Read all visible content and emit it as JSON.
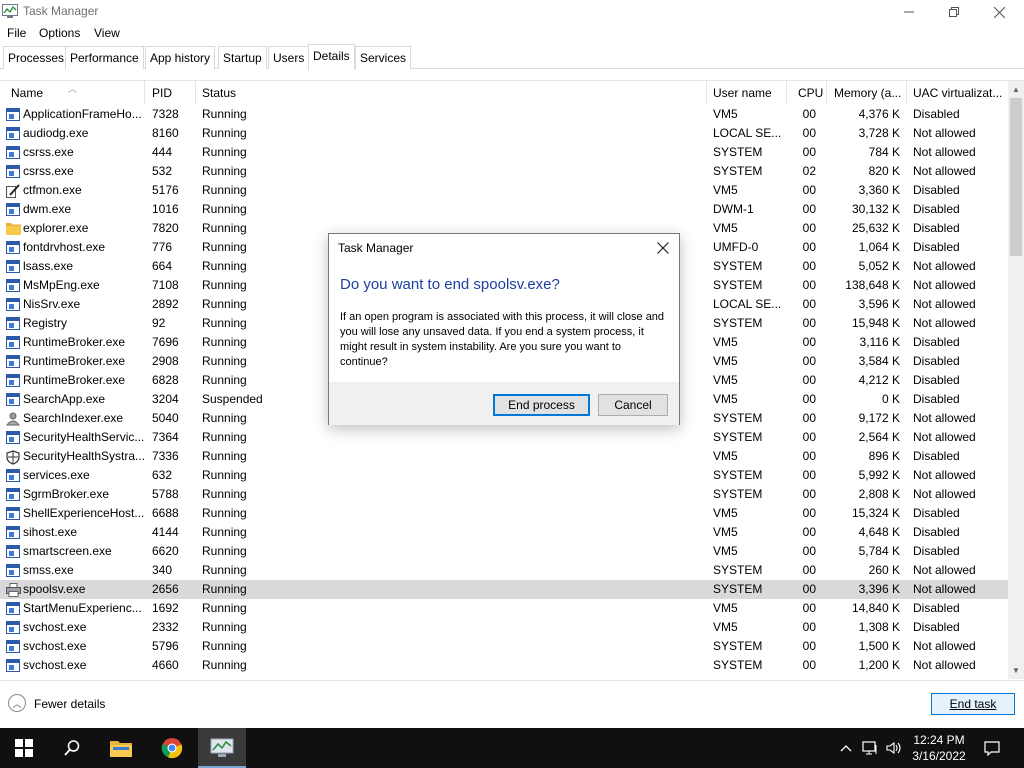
{
  "window": {
    "title": "Task Manager",
    "menu": [
      "File",
      "Options",
      "View"
    ]
  },
  "tabs": [
    "Processes",
    "Performance",
    "App history",
    "Startup",
    "Users",
    "Details",
    "Services"
  ],
  "active_tab": "Details",
  "columns": {
    "name": "Name",
    "pid": "PID",
    "status": "Status",
    "user": "User name",
    "cpu": "CPU",
    "memory": "Memory (a...",
    "uac": "UAC virtualizat..."
  },
  "rows": [
    {
      "name": "ApplicationFrameHo...",
      "pid": "7328",
      "status": "Running",
      "user": "VM5",
      "cpu": "00",
      "memory": "4,376 K",
      "uac": "Disabled",
      "icon": "window-icon"
    },
    {
      "name": "audiodg.exe",
      "pid": "8160",
      "status": "Running",
      "user": "LOCAL SE...",
      "cpu": "00",
      "memory": "3,728 K",
      "uac": "Not allowed",
      "icon": "window-icon"
    },
    {
      "name": "csrss.exe",
      "pid": "444",
      "status": "Running",
      "user": "SYSTEM",
      "cpu": "00",
      "memory": "784 K",
      "uac": "Not allowed",
      "icon": "window-icon"
    },
    {
      "name": "csrss.exe",
      "pid": "532",
      "status": "Running",
      "user": "SYSTEM",
      "cpu": "02",
      "memory": "820 K",
      "uac": "Not allowed",
      "icon": "window-icon"
    },
    {
      "name": "ctfmon.exe",
      "pid": "5176",
      "status": "Running",
      "user": "VM5",
      "cpu": "00",
      "memory": "3,360 K",
      "uac": "Disabled",
      "icon": "pen-icon"
    },
    {
      "name": "dwm.exe",
      "pid": "1016",
      "status": "Running",
      "user": "DWM-1",
      "cpu": "00",
      "memory": "30,132 K",
      "uac": "Disabled",
      "icon": "window-icon"
    },
    {
      "name": "explorer.exe",
      "pid": "7820",
      "status": "Running",
      "user": "VM5",
      "cpu": "00",
      "memory": "25,632 K",
      "uac": "Disabled",
      "icon": "folder-icon"
    },
    {
      "name": "fontdrvhost.exe",
      "pid": "776",
      "status": "Running",
      "user": "UMFD-0",
      "cpu": "00",
      "memory": "1,064 K",
      "uac": "Disabled",
      "icon": "window-icon"
    },
    {
      "name": "lsass.exe",
      "pid": "664",
      "status": "Running",
      "user": "SYSTEM",
      "cpu": "00",
      "memory": "5,052 K",
      "uac": "Not allowed",
      "icon": "window-icon"
    },
    {
      "name": "MsMpEng.exe",
      "pid": "7108",
      "status": "Running",
      "user": "SYSTEM",
      "cpu": "00",
      "memory": "138,648 K",
      "uac": "Not allowed",
      "icon": "window-icon"
    },
    {
      "name": "NisSrv.exe",
      "pid": "2892",
      "status": "Running",
      "user": "LOCAL SE...",
      "cpu": "00",
      "memory": "3,596 K",
      "uac": "Not allowed",
      "icon": "window-icon"
    },
    {
      "name": "Registry",
      "pid": "92",
      "status": "Running",
      "user": "SYSTEM",
      "cpu": "00",
      "memory": "15,948 K",
      "uac": "Not allowed",
      "icon": "window-icon"
    },
    {
      "name": "RuntimeBroker.exe",
      "pid": "7696",
      "status": "Running",
      "user": "VM5",
      "cpu": "00",
      "memory": "3,116 K",
      "uac": "Disabled",
      "icon": "window-icon"
    },
    {
      "name": "RuntimeBroker.exe",
      "pid": "2908",
      "status": "Running",
      "user": "VM5",
      "cpu": "00",
      "memory": "3,584 K",
      "uac": "Disabled",
      "icon": "window-icon"
    },
    {
      "name": "RuntimeBroker.exe",
      "pid": "6828",
      "status": "Running",
      "user": "VM5",
      "cpu": "00",
      "memory": "4,212 K",
      "uac": "Disabled",
      "icon": "window-icon"
    },
    {
      "name": "SearchApp.exe",
      "pid": "3204",
      "status": "Suspended",
      "user": "VM5",
      "cpu": "00",
      "memory": "0 K",
      "uac": "Disabled",
      "icon": "window-icon"
    },
    {
      "name": "SearchIndexer.exe",
      "pid": "5040",
      "status": "Running",
      "user": "SYSTEM",
      "cpu": "00",
      "memory": "9,172 K",
      "uac": "Not allowed",
      "icon": "indexer-icon"
    },
    {
      "name": "SecurityHealthServic...",
      "pid": "7364",
      "status": "Running",
      "user": "SYSTEM",
      "cpu": "00",
      "memory": "2,564 K",
      "uac": "Not allowed",
      "icon": "window-icon"
    },
    {
      "name": "SecurityHealthSystra...",
      "pid": "7336",
      "status": "Running",
      "user": "VM5",
      "cpu": "00",
      "memory": "896 K",
      "uac": "Disabled",
      "icon": "shield-icon"
    },
    {
      "name": "services.exe",
      "pid": "632",
      "status": "Running",
      "user": "SYSTEM",
      "cpu": "00",
      "memory": "5,992 K",
      "uac": "Not allowed",
      "icon": "window-icon"
    },
    {
      "name": "SgrmBroker.exe",
      "pid": "5788",
      "status": "Running",
      "user": "SYSTEM",
      "cpu": "00",
      "memory": "2,808 K",
      "uac": "Not allowed",
      "icon": "window-icon"
    },
    {
      "name": "ShellExperienceHost....",
      "pid": "6688",
      "status": "Running",
      "user": "VM5",
      "cpu": "00",
      "memory": "15,324 K",
      "uac": "Disabled",
      "icon": "window-icon"
    },
    {
      "name": "sihost.exe",
      "pid": "4144",
      "status": "Running",
      "user": "VM5",
      "cpu": "00",
      "memory": "4,648 K",
      "uac": "Disabled",
      "icon": "window-icon"
    },
    {
      "name": "smartscreen.exe",
      "pid": "6620",
      "status": "Running",
      "user": "VM5",
      "cpu": "00",
      "memory": "5,784 K",
      "uac": "Disabled",
      "icon": "window-icon"
    },
    {
      "name": "smss.exe",
      "pid": "340",
      "status": "Running",
      "user": "SYSTEM",
      "cpu": "00",
      "memory": "260 K",
      "uac": "Not allowed",
      "icon": "window-icon"
    },
    {
      "name": "spoolsv.exe",
      "pid": "2656",
      "status": "Running",
      "user": "SYSTEM",
      "cpu": "00",
      "memory": "3,396 K",
      "uac": "Not allowed",
      "icon": "printer-icon",
      "selected": true
    },
    {
      "name": "StartMenuExperienc...",
      "pid": "1692",
      "status": "Running",
      "user": "VM5",
      "cpu": "00",
      "memory": "14,840 K",
      "uac": "Disabled",
      "icon": "window-icon"
    },
    {
      "name": "svchost.exe",
      "pid": "2332",
      "status": "Running",
      "user": "VM5",
      "cpu": "00",
      "memory": "1,308 K",
      "uac": "Disabled",
      "icon": "window-icon"
    },
    {
      "name": "svchost.exe",
      "pid": "5796",
      "status": "Running",
      "user": "SYSTEM",
      "cpu": "00",
      "memory": "1,500 K",
      "uac": "Not allowed",
      "icon": "window-icon"
    },
    {
      "name": "svchost.exe",
      "pid": "4660",
      "status": "Running",
      "user": "SYSTEM",
      "cpu": "00",
      "memory": "1,200 K",
      "uac": "Not allowed",
      "icon": "window-icon"
    }
  ],
  "footer": {
    "fewer_details": "Fewer details",
    "end_task": "End task"
  },
  "dialog": {
    "title": "Task Manager",
    "heading": "Do you want to end spoolsv.exe?",
    "body": "If an open program is associated with this process, it will close and you will lose any unsaved data. If you end a system process, it might result in system instability. Are you sure you want to continue?",
    "confirm": "End process",
    "cancel": "Cancel"
  },
  "taskbar": {
    "time": "12:24 PM",
    "date": "3/16/2022"
  },
  "colors": {
    "accent": "#0078d7",
    "dialog_heading": "#1e3fa0",
    "selected_row": "#d9d9d9",
    "taskbar": "#101010"
  }
}
